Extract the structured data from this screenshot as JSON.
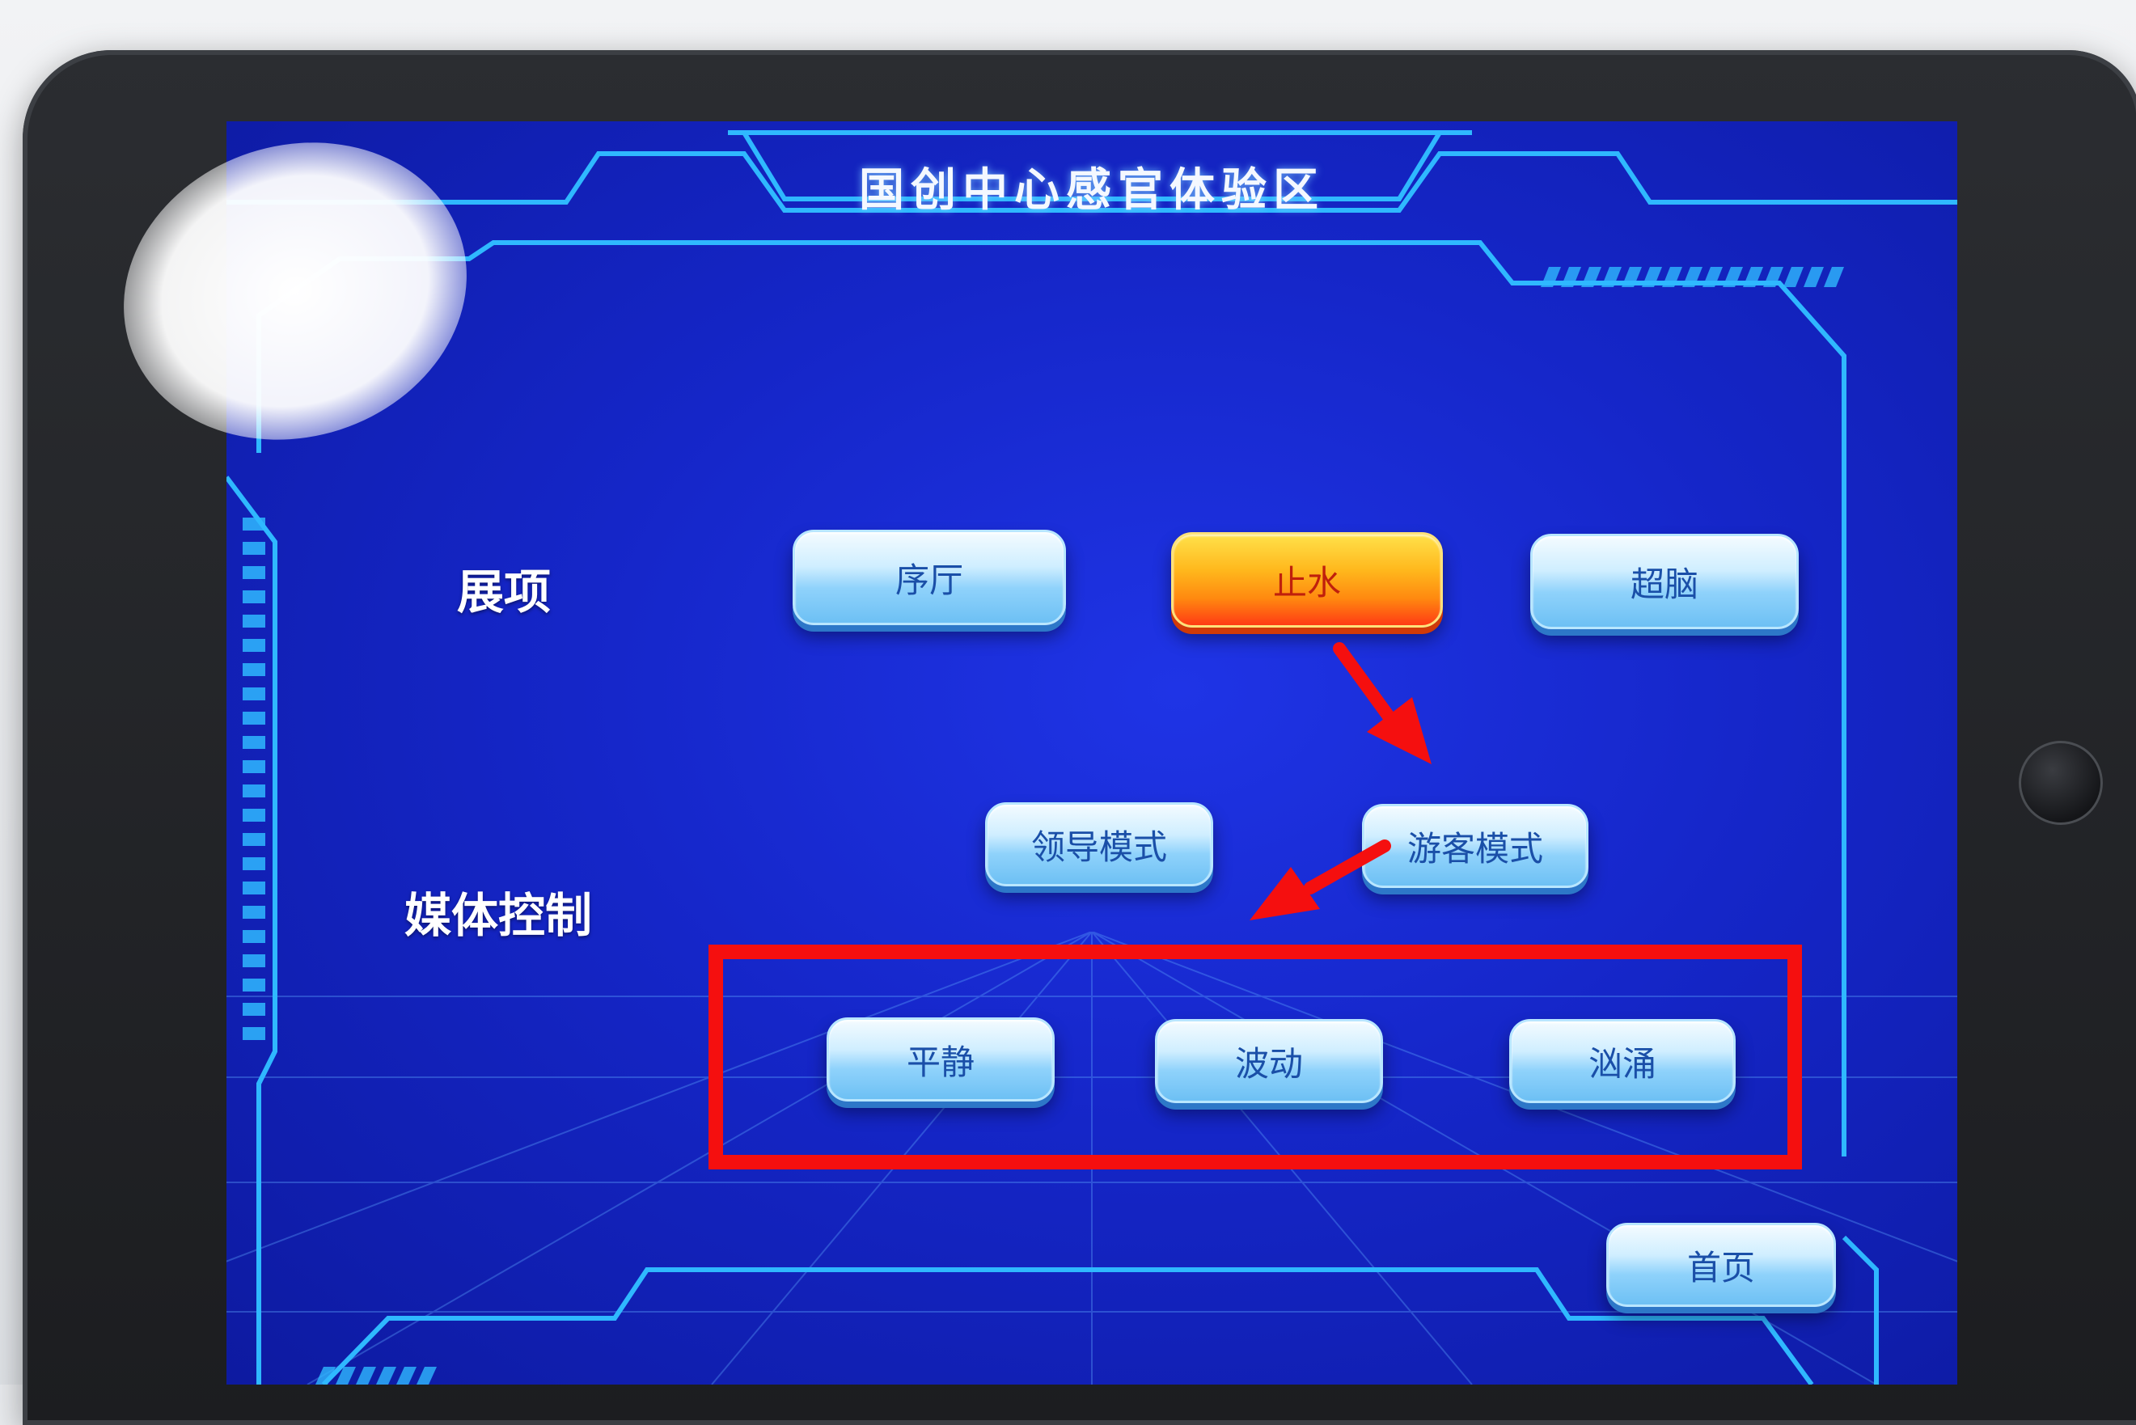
{
  "screen": {
    "title": "国创中心感官体验区"
  },
  "sections": {
    "exhibits_label": "展项",
    "media_label": "媒体控制"
  },
  "exhibit_buttons": [
    {
      "label": "序厅",
      "state": "normal"
    },
    {
      "label": "止水",
      "state": "active"
    },
    {
      "label": "超脑",
      "state": "normal"
    }
  ],
  "mode_buttons": [
    {
      "label": "领导模式"
    },
    {
      "label": "游客模式"
    }
  ],
  "media_buttons": [
    {
      "label": "平静"
    },
    {
      "label": "波动"
    },
    {
      "label": "汹涌"
    }
  ],
  "nav": {
    "home_label": "首页"
  },
  "colors": {
    "screen_bg": "#1526c8",
    "frame_line": "#2fb8ff",
    "button_face": "#8fd2fb",
    "active_button": "#ff8a10",
    "annotation_red": "#f50f0f"
  },
  "annotations": {
    "arrows": [
      "down-right-arrow",
      "down-left-arrow"
    ],
    "highlight": "red-rectangle-around-media-buttons"
  }
}
